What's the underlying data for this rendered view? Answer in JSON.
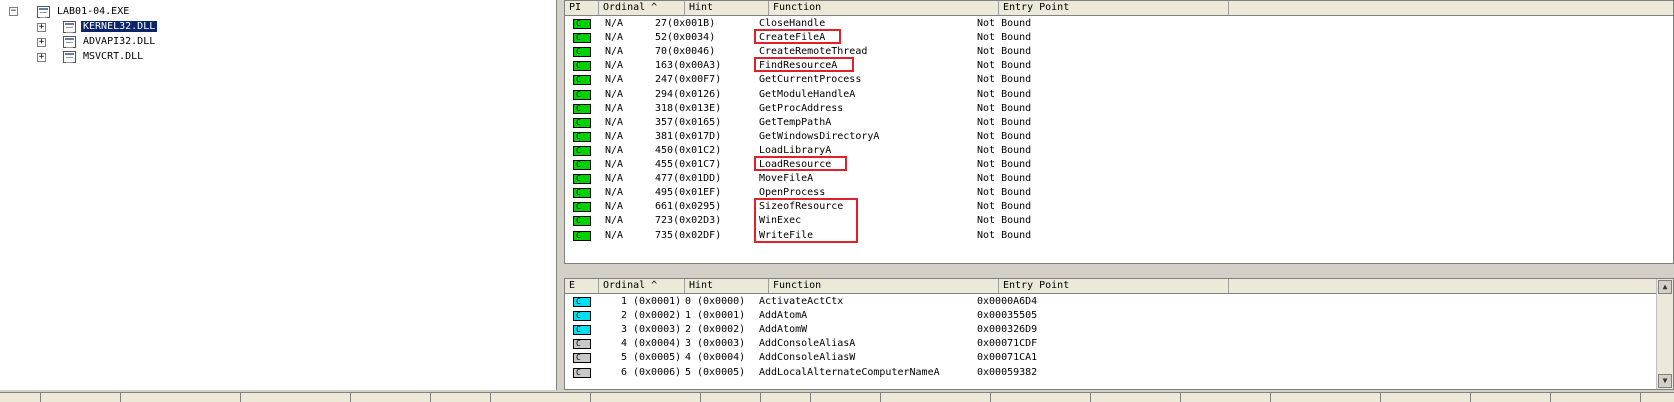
{
  "tree": {
    "root": "LAB01-04.EXE",
    "children": [
      {
        "label": "KERNEL32.DLL",
        "selected": true
      },
      {
        "label": "ADVAPI32.DLL",
        "selected": false
      },
      {
        "label": "MSVCRT.DLL",
        "selected": false
      }
    ]
  },
  "imports": {
    "columns": [
      "PI",
      "Ordinal ^",
      "Hint",
      "Function",
      "Entry Point"
    ],
    "rows": [
      {
        "ord": "N/A",
        "hint_n": "27",
        "hint_h": "(0x001B)",
        "func": "CloseHandle",
        "ep": "Not Bound"
      },
      {
        "ord": "N/A",
        "hint_n": "52",
        "hint_h": "(0x0034)",
        "func": "CreateFileA",
        "ep": "Not Bound"
      },
      {
        "ord": "N/A",
        "hint_n": "70",
        "hint_h": "(0x0046)",
        "func": "CreateRemoteThread",
        "ep": "Not Bound"
      },
      {
        "ord": "N/A",
        "hint_n": "163",
        "hint_h": "(0x00A3)",
        "func": "FindResourceA",
        "ep": "Not Bound"
      },
      {
        "ord": "N/A",
        "hint_n": "247",
        "hint_h": "(0x00F7)",
        "func": "GetCurrentProcess",
        "ep": "Not Bound"
      },
      {
        "ord": "N/A",
        "hint_n": "294",
        "hint_h": "(0x0126)",
        "func": "GetModuleHandleA",
        "ep": "Not Bound"
      },
      {
        "ord": "N/A",
        "hint_n": "318",
        "hint_h": "(0x013E)",
        "func": "GetProcAddress",
        "ep": "Not Bound"
      },
      {
        "ord": "N/A",
        "hint_n": "357",
        "hint_h": "(0x0165)",
        "func": "GetTempPathA",
        "ep": "Not Bound"
      },
      {
        "ord": "N/A",
        "hint_n": "381",
        "hint_h": "(0x017D)",
        "func": "GetWindowsDirectoryA",
        "ep": "Not Bound"
      },
      {
        "ord": "N/A",
        "hint_n": "450",
        "hint_h": "(0x01C2)",
        "func": "LoadLibraryA",
        "ep": "Not Bound"
      },
      {
        "ord": "N/A",
        "hint_n": "455",
        "hint_h": "(0x01C7)",
        "func": "LoadResource",
        "ep": "Not Bound"
      },
      {
        "ord": "N/A",
        "hint_n": "477",
        "hint_h": "(0x01DD)",
        "func": "MoveFileA",
        "ep": "Not Bound"
      },
      {
        "ord": "N/A",
        "hint_n": "495",
        "hint_h": "(0x01EF)",
        "func": "OpenProcess",
        "ep": "Not Bound"
      },
      {
        "ord": "N/A",
        "hint_n": "661",
        "hint_h": "(0x0295)",
        "func": "SizeofResource",
        "ep": "Not Bound"
      },
      {
        "ord": "N/A",
        "hint_n": "723",
        "hint_h": "(0x02D3)",
        "func": "WinExec",
        "ep": "Not Bound"
      },
      {
        "ord": "N/A",
        "hint_n": "735",
        "hint_h": "(0x02DF)",
        "func": "WriteFile",
        "ep": "Not Bound"
      }
    ]
  },
  "exports": {
    "columns": [
      "E",
      "Ordinal ^",
      "Hint",
      "Function",
      "Entry Point"
    ],
    "rows": [
      {
        "ord_n": "1",
        "ord_h": "(0x0001)",
        "hint_n": "0",
        "hint_h": "(0x0000)",
        "func": "ActivateActCtx",
        "ep": "0x0000A6D4",
        "color": "cyan"
      },
      {
        "ord_n": "2",
        "ord_h": "(0x0002)",
        "hint_n": "1",
        "hint_h": "(0x0001)",
        "func": "AddAtomA",
        "ep": "0x00035505",
        "color": "cyan"
      },
      {
        "ord_n": "3",
        "ord_h": "(0x0003)",
        "hint_n": "2",
        "hint_h": "(0x0002)",
        "func": "AddAtomW",
        "ep": "0x000326D9",
        "color": "cyan"
      },
      {
        "ord_n": "4",
        "ord_h": "(0x0004)",
        "hint_n": "3",
        "hint_h": "(0x0003)",
        "func": "AddConsoleAliasA",
        "ep": "0x00071CDF",
        "color": "gray"
      },
      {
        "ord_n": "5",
        "ord_h": "(0x0005)",
        "hint_n": "4",
        "hint_h": "(0x0004)",
        "func": "AddConsoleAliasW",
        "ep": "0x00071CA1",
        "color": "gray"
      },
      {
        "ord_n": "6",
        "ord_h": "(0x0006)",
        "hint_n": "5",
        "hint_h": "(0x0005)",
        "func": "AddLocalAlternateComputerNameA",
        "ep": "0x00059382",
        "color": "gray"
      }
    ]
  },
  "badge_letter": "C",
  "colors": {
    "green": "#00d200",
    "cyan": "#00e0f0",
    "gray": "#c8c8c8",
    "highlight": "#e1202a"
  },
  "icons": {
    "expand": "plus-icon",
    "collapse": "minus-icon",
    "scroll_up": "scroll-up-arrow-icon",
    "scroll_down": "scroll-down-arrow-icon"
  }
}
